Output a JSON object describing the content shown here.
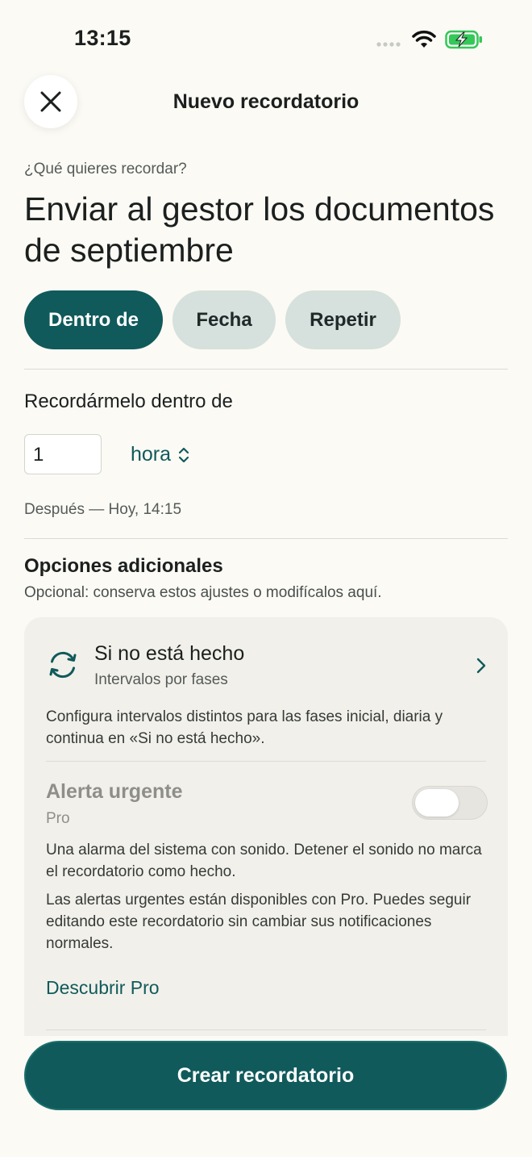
{
  "status_bar": {
    "time": "13:15"
  },
  "header": {
    "title": "Nuevo recordatorio",
    "close_icon": "close-icon"
  },
  "reminder": {
    "question": "¿Qué quieres recordar?",
    "text": "Enviar al gestor los documentos de septiembre"
  },
  "tabs": [
    {
      "label": "Dentro de",
      "active": true
    },
    {
      "label": "Fecha",
      "active": false
    },
    {
      "label": "Repetir",
      "active": false
    }
  ],
  "within": {
    "label": "Recordármelo dentro de",
    "amount": "1",
    "unit": "hora",
    "after": "Después — Hoy, 14:15"
  },
  "options": {
    "title": "Opciones adicionales",
    "subtitle": "Opcional: conserva estos ajustes o modifícalos aquí.",
    "not_done": {
      "title": "Si no está hecho",
      "subtitle": "Intervalos por fases",
      "description": "Configura intervalos distintos para las fases inicial, diaria y continua en «Si no está hecho».",
      "icon": "repeat-icon"
    },
    "urgent": {
      "title": "Alerta urgente",
      "badge": "Pro",
      "enabled": false,
      "description": "Una alarma del sistema con sonido. Detener el sonido no marca el recordatorio como hecho.",
      "pro_note": "Las alertas urgentes están disponibles con Pro. Puedes seguir editando este recordatorio sin cambiar sus notificaciones normales.",
      "discover_label": "Descubrir Pro"
    }
  },
  "footer": {
    "create_label": "Crear recordatorio"
  },
  "colors": {
    "accent": "#105a5b",
    "background": "#fbfaf5",
    "chip": "#d6e0dd",
    "card": "#f2f0ea"
  }
}
